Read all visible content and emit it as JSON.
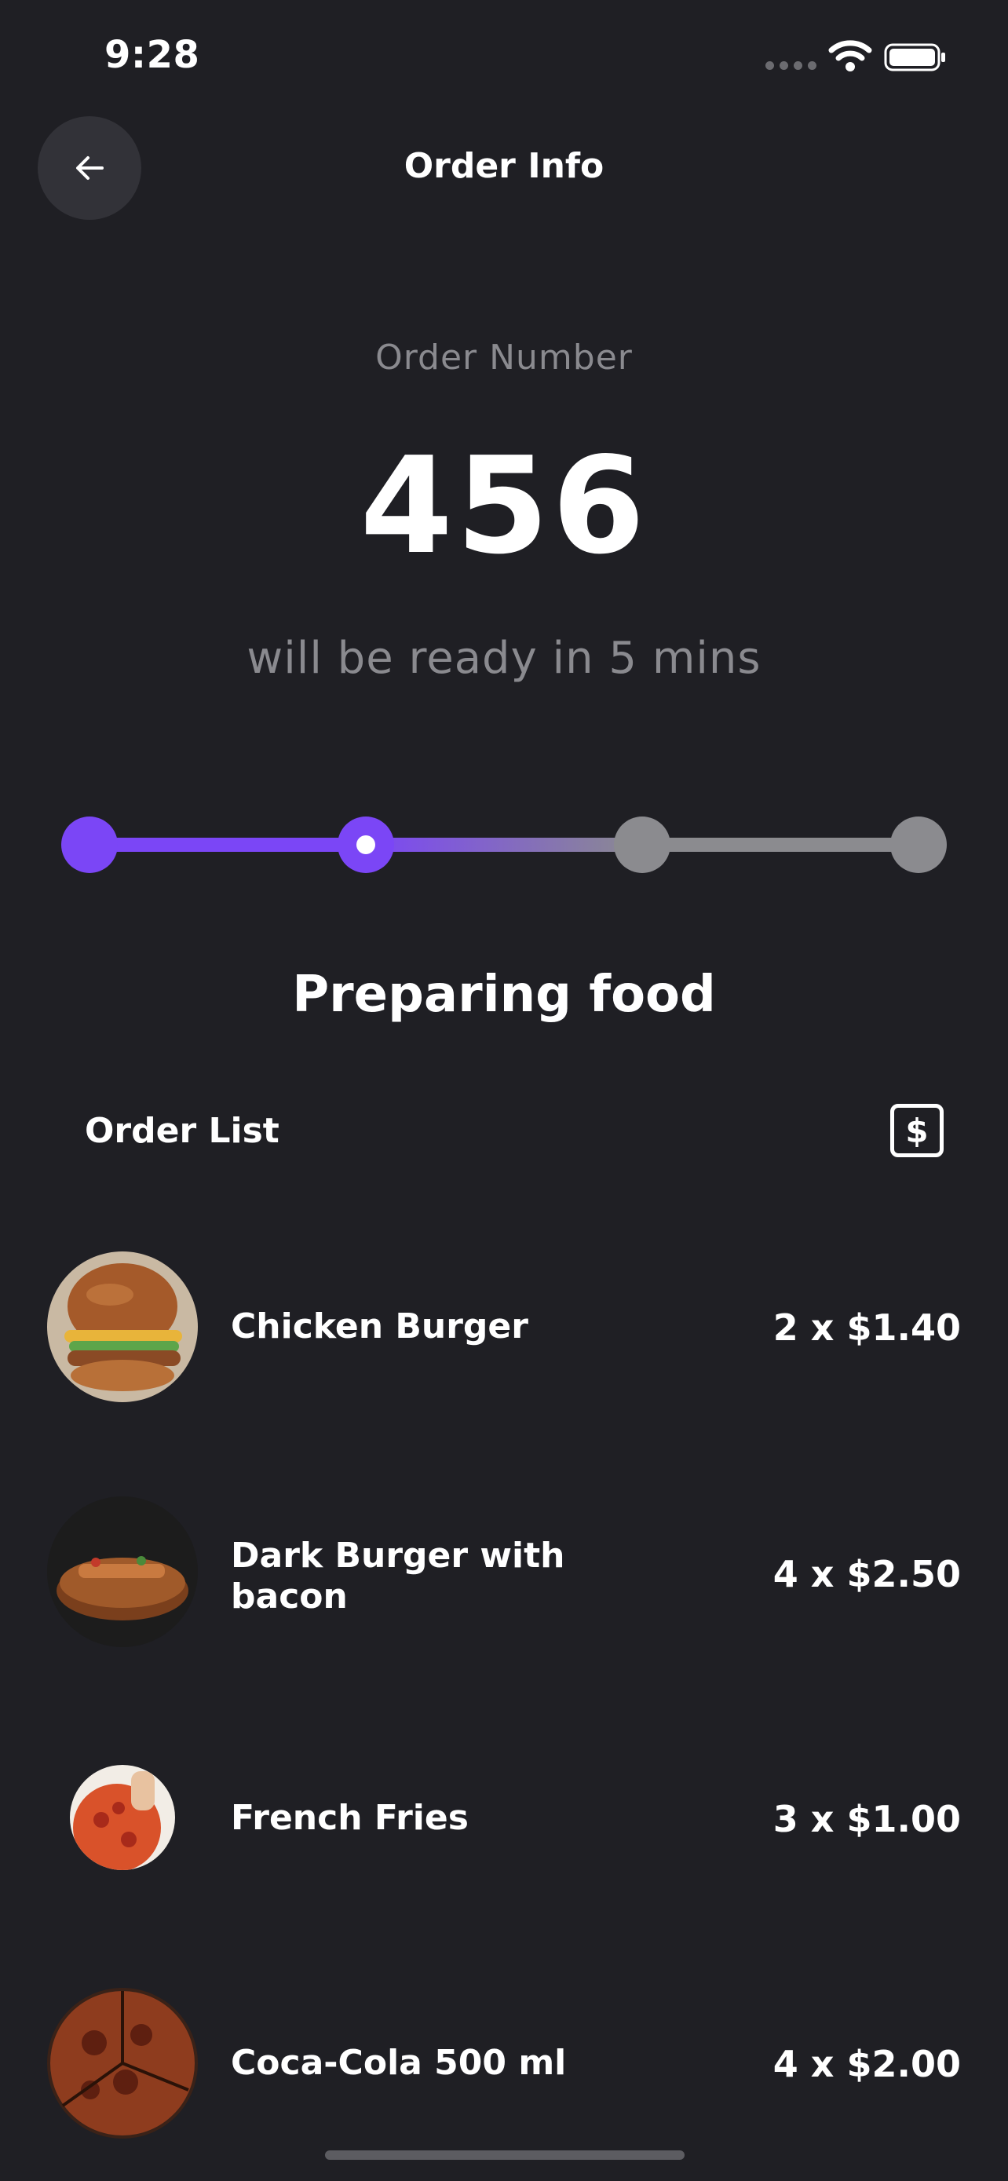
{
  "status_bar": {
    "time": "9:28"
  },
  "header": {
    "title": "Order Info"
  },
  "order": {
    "number_label": "Order Number",
    "number": "456",
    "ready_text": "will be ready in 5 mins"
  },
  "progress": {
    "current_step": 2,
    "total_steps": 4,
    "stage_label": "Preparing food"
  },
  "order_list": {
    "title": "Order List",
    "items": [
      {
        "name": "Chicken Burger",
        "price": "2 x $1.40"
      },
      {
        "name": "Dark Burger with bacon",
        "price": "4 x $2.50"
      },
      {
        "name": "French Fries",
        "price": "3 x $1.00"
      },
      {
        "name": "Coca-Cola 500 ml",
        "price": "4 x $2.00"
      }
    ]
  },
  "icons": {
    "back": "arrow-left-icon",
    "bill": "dollar-icon",
    "signal": "cellular-signal-icon",
    "wifi": "wifi-icon",
    "battery": "battery-icon"
  },
  "colors": {
    "background": "#1f1f24",
    "accent": "#7b46f6",
    "muted": "#8a8a8f",
    "inactive_step": "#8b8b8f"
  }
}
